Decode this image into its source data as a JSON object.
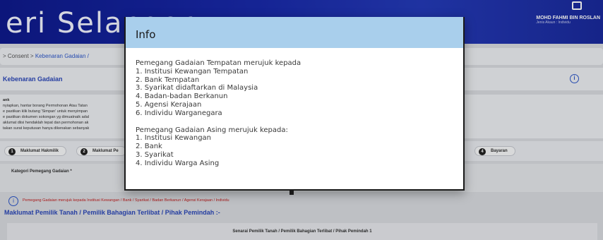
{
  "header": {
    "brand": "eri Selangor",
    "user_name": "MOHD FAHMI BIN ROSLAN",
    "user_role": "Jenis Akaun : Individu"
  },
  "breadcrumb": {
    "prefix": "> Consent >",
    "current": "Kebenaran Gadaian /"
  },
  "section": {
    "title": "Kebenaran Gadaian",
    "info_icon": "info-icon"
  },
  "notes": {
    "lines": [
      "ank",
      "nyiapkan, hantar borang Permohonan Atau Tatan",
      "e pastikan klik butang 'Simpan' untuk menyimpan",
      "e pastikan dokumen sokongan yg dimuatnaik adal",
      "aklumat diisi hendaklah tepat dan permohonan ak",
      "takan surat keputusan hanya dikenakan sebanyak"
    ]
  },
  "tabs": [
    {
      "num": "1",
      "label": "Maklumat Hakmilik"
    },
    {
      "num": "2",
      "label": "Maklumat Pe"
    },
    {
      "num": "4",
      "label": "Bayaran"
    }
  ],
  "field": {
    "label": "Kategori Pemegang Gadaian *"
  },
  "hint": {
    "icon": "info-icon",
    "text": "Pemegang Gadaian merujuk kepada Institusi Kewangan / Bank / Syarikat / Badan Berkanun / Agensi Kerajaan / Individu"
  },
  "subhead": "Maklumat Pemilik Tanah / Pemilik Bahagian Terlibat / Pihak Pemindah :-",
  "table_header": "Senarai Pemilik Tanah / Pemilik Bahagian Terlibat / Pihak Pemindah 1",
  "modal": {
    "title": "Info",
    "group1_heading": "Pemegang Gadaian Tempatan merujuk kepada",
    "group1_items": [
      "1. Institusi Kewangan Tempatan",
      "2. Bank Tempatan",
      "3. Syarikat didaftarkan di Malaysia",
      "4. Badan-badan Berkanun",
      "5. Agensi Kerajaan",
      "6. Individu Warganegara"
    ],
    "group2_heading": "Pemegang Gadaian Asing merujuk kepada:",
    "group2_items": [
      "1. Institusi Kewangan",
      "2. Bank",
      "3. Syarikat",
      "4. Individu Warga Asing"
    ]
  }
}
